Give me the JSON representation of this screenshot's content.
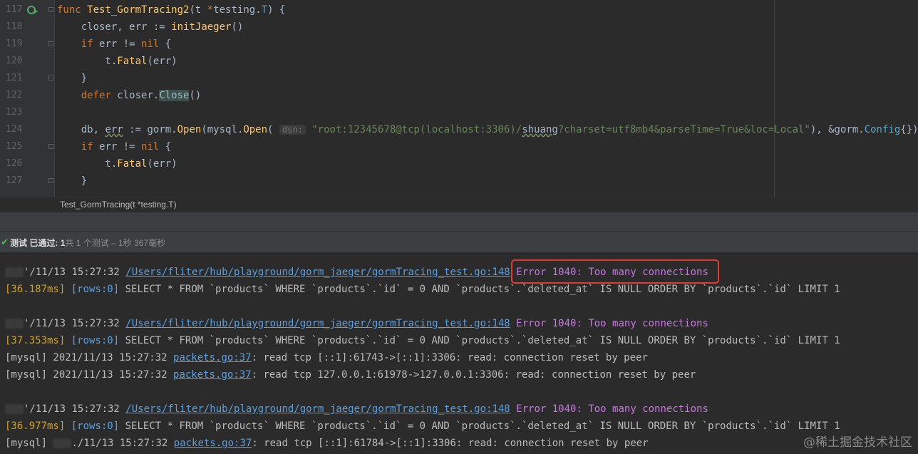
{
  "editor": {
    "lines": [
      {
        "n": "117",
        "parts": [
          [
            "kw",
            "func "
          ],
          [
            "fn",
            "Test_GormTracing2"
          ],
          [
            "pkg",
            "(t "
          ],
          [
            "kw",
            "*"
          ],
          [
            "pkg",
            "testing."
          ],
          [
            "typ",
            "T"
          ],
          [
            "pkg",
            ") {"
          ]
        ]
      },
      {
        "n": "118",
        "parts": [
          [
            "pkg",
            "    closer, "
          ],
          [
            "pkg",
            "err"
          ],
          [
            "pkg",
            " := "
          ],
          [
            "fn",
            "initJaeger"
          ],
          [
            "pkg",
            "()"
          ]
        ]
      },
      {
        "n": "119",
        "parts": [
          [
            "kw",
            "    if "
          ],
          [
            "pkg",
            "err != "
          ],
          [
            "kw",
            "nil"
          ],
          [
            "pkg",
            " {"
          ]
        ]
      },
      {
        "n": "120",
        "parts": [
          [
            "pkg",
            "        t."
          ],
          [
            "fn",
            "Fatal"
          ],
          [
            "pkg",
            "(err)"
          ]
        ]
      },
      {
        "n": "121",
        "parts": [
          [
            "pkg",
            "    }"
          ]
        ]
      },
      {
        "n": "122",
        "parts": [
          [
            "kw",
            "    defer "
          ],
          [
            "pkg",
            "closer."
          ],
          [
            "hl",
            "Close"
          ],
          [
            "pkg",
            "()"
          ]
        ]
      },
      {
        "n": "123",
        "parts": [
          [
            "pkg",
            ""
          ]
        ]
      },
      {
        "n": "124",
        "parts": [
          [
            "pkg",
            "    db, "
          ],
          [
            "squig",
            "err"
          ],
          [
            "pkg",
            " := gorm."
          ],
          [
            "fn",
            "Open"
          ],
          [
            "pkg",
            "(mysql."
          ],
          [
            "fn",
            "Open"
          ],
          [
            "pkg",
            "( "
          ],
          [
            "hint",
            "dsn:"
          ],
          [
            "str",
            " \"root:12345678@tcp(localhost:3306)/"
          ],
          [
            "squig",
            "shuang"
          ],
          [
            "str",
            "?charset=utf8mb4&parseTime=True&loc=Local\""
          ],
          [
            "pkg",
            "), &gorm."
          ],
          [
            "method",
            "Config"
          ],
          [
            "pkg",
            "{})"
          ]
        ]
      },
      {
        "n": "125",
        "parts": [
          [
            "kw",
            "    if "
          ],
          [
            "pkg",
            "err != "
          ],
          [
            "kw",
            "nil"
          ],
          [
            "pkg",
            " {"
          ]
        ]
      },
      {
        "n": "126",
        "parts": [
          [
            "pkg",
            "        t."
          ],
          [
            "fn",
            "Fatal"
          ],
          [
            "pkg",
            "(err)"
          ]
        ]
      },
      {
        "n": "127",
        "parts": [
          [
            "pkg",
            "    }"
          ]
        ]
      }
    ],
    "breadcrumb": "Test_GormTracing(t *testing.T)"
  },
  "status": {
    "check": "✔",
    "label": "测试 已通过:",
    "count": "1",
    "suffix": "共 1 个测试 – 1秒 367毫秒"
  },
  "console": {
    "lines": [
      {
        "parts": [
          [
            "blur",
            ""
          ],
          [
            "txt",
            "'/11/13 15:27:32 "
          ],
          [
            "link",
            "/Users/fliter/hub/playground/gorm_jaeger/gormTracing_test.go:148"
          ],
          [
            "txt",
            " "
          ],
          [
            "err",
            "Error 1040: Too many connections"
          ]
        ]
      },
      {
        "parts": [
          [
            "ms",
            "[36.187ms]"
          ],
          [
            "txt",
            " "
          ],
          [
            "rows",
            "[rows:0]"
          ],
          [
            "txt",
            " SELECT * FROM `products` WHERE `products`.`id` = 0 AND `products`.`deleted_at` IS NULL ORDER BY `products`.`id` LIMIT 1"
          ]
        ]
      },
      {
        "parts": [
          [
            "txt",
            ""
          ]
        ]
      },
      {
        "parts": [
          [
            "blur",
            ""
          ],
          [
            "txt",
            "'/11/13 15:27:32 "
          ],
          [
            "link",
            "/Users/fliter/hub/playground/gorm_jaeger/gormTracing_test.go:148"
          ],
          [
            "txt",
            " "
          ],
          [
            "err",
            "Error 1040: Too many connections"
          ]
        ]
      },
      {
        "parts": [
          [
            "ms",
            "[37.353ms]"
          ],
          [
            "txt",
            " "
          ],
          [
            "rows",
            "[rows:0]"
          ],
          [
            "txt",
            " SELECT * FROM `products` WHERE `products`.`id` = 0 AND `products`.`deleted_at` IS NULL ORDER BY `products`.`id` LIMIT 1"
          ]
        ]
      },
      {
        "parts": [
          [
            "txt",
            "[mysql] 2021/11/13 15:27:32 "
          ],
          [
            "link",
            "packets.go:37"
          ],
          [
            "txt",
            ": read tcp [::1]:61743->[::1]:3306: read: connection reset by peer"
          ]
        ]
      },
      {
        "parts": [
          [
            "txt",
            "[mysql] 2021/11/13 15:27:32 "
          ],
          [
            "link",
            "packets.go:37"
          ],
          [
            "txt",
            ": read tcp 127.0.0.1:61978->127.0.0.1:3306: read: connection reset by peer"
          ]
        ]
      },
      {
        "parts": [
          [
            "txt",
            ""
          ]
        ]
      },
      {
        "parts": [
          [
            "blur",
            ""
          ],
          [
            "txt",
            "'/11/13 15:27:32 "
          ],
          [
            "link",
            "/Users/fliter/hub/playground/gorm_jaeger/gormTracing_test.go:148"
          ],
          [
            "txt",
            " "
          ],
          [
            "err",
            "Error 1040: Too many connections"
          ]
        ]
      },
      {
        "parts": [
          [
            "ms",
            "[36.977ms]"
          ],
          [
            "txt",
            " "
          ],
          [
            "rows",
            "[rows:0]"
          ],
          [
            "txt",
            " SELECT * FROM `products` WHERE `products`.`id` = 0 AND `products`.`deleted_at` IS NULL ORDER BY `products`.`id` LIMIT 1"
          ]
        ]
      },
      {
        "parts": [
          [
            "txt",
            "[mysql] "
          ],
          [
            "blur",
            ""
          ],
          [
            "txt",
            "./11/13 15:27:32 "
          ],
          [
            "link",
            "packets.go:37"
          ],
          [
            "txt",
            ": read tcp [::1]:61784->[::1]:3306: read: connection reset by peer"
          ]
        ]
      }
    ]
  },
  "watermark": "@稀土掘金技术社区",
  "colors": {
    "error_box": "#e03c31",
    "link": "#5c9fdf",
    "error_text": "#c678dd",
    "timing": "#d1a02a"
  }
}
